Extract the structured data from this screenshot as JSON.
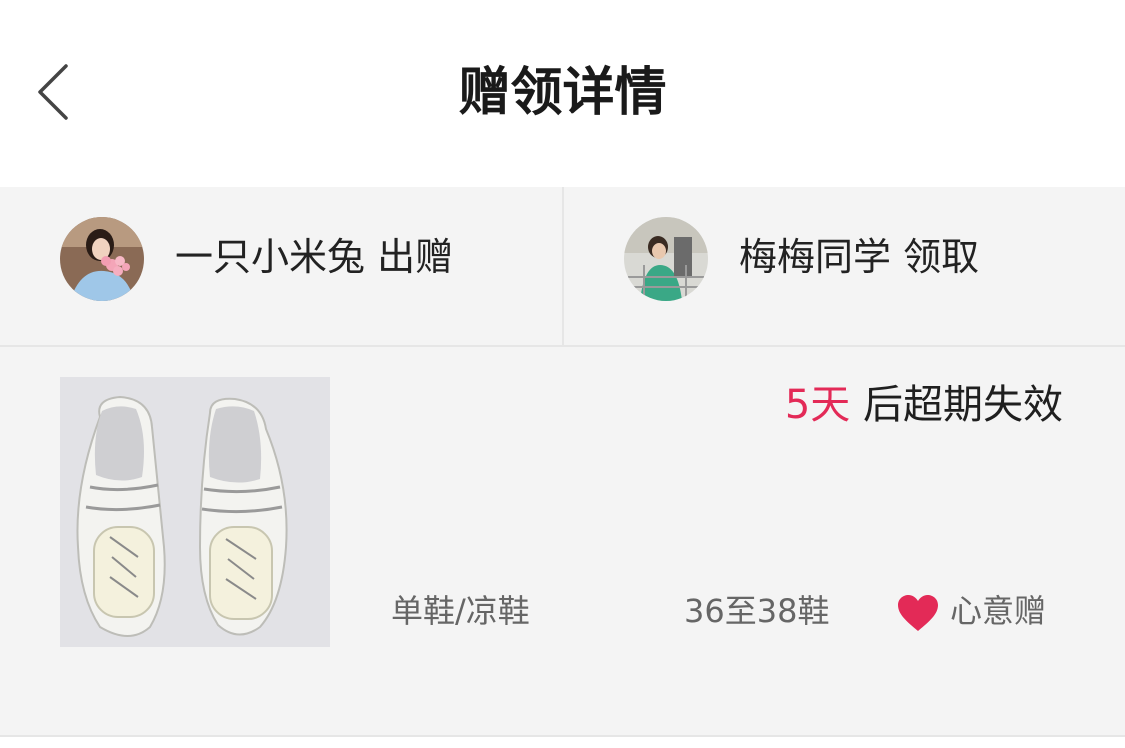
{
  "header": {
    "title": "赠领详情",
    "back_icon": "chevron-left-icon"
  },
  "parties": {
    "giver": {
      "name": "一只小米兔",
      "action": "出赠",
      "avatar": "avatar-image"
    },
    "receiver": {
      "name": "梅梅同学",
      "action": "领取",
      "avatar": "avatar-image"
    }
  },
  "item": {
    "expiry_days": "5天",
    "expiry_suffix": "后超期失效",
    "category": "单鞋/凉鞋",
    "size": "36至38鞋",
    "gift_type": "心意赠",
    "accent_color": "#e32a57"
  }
}
